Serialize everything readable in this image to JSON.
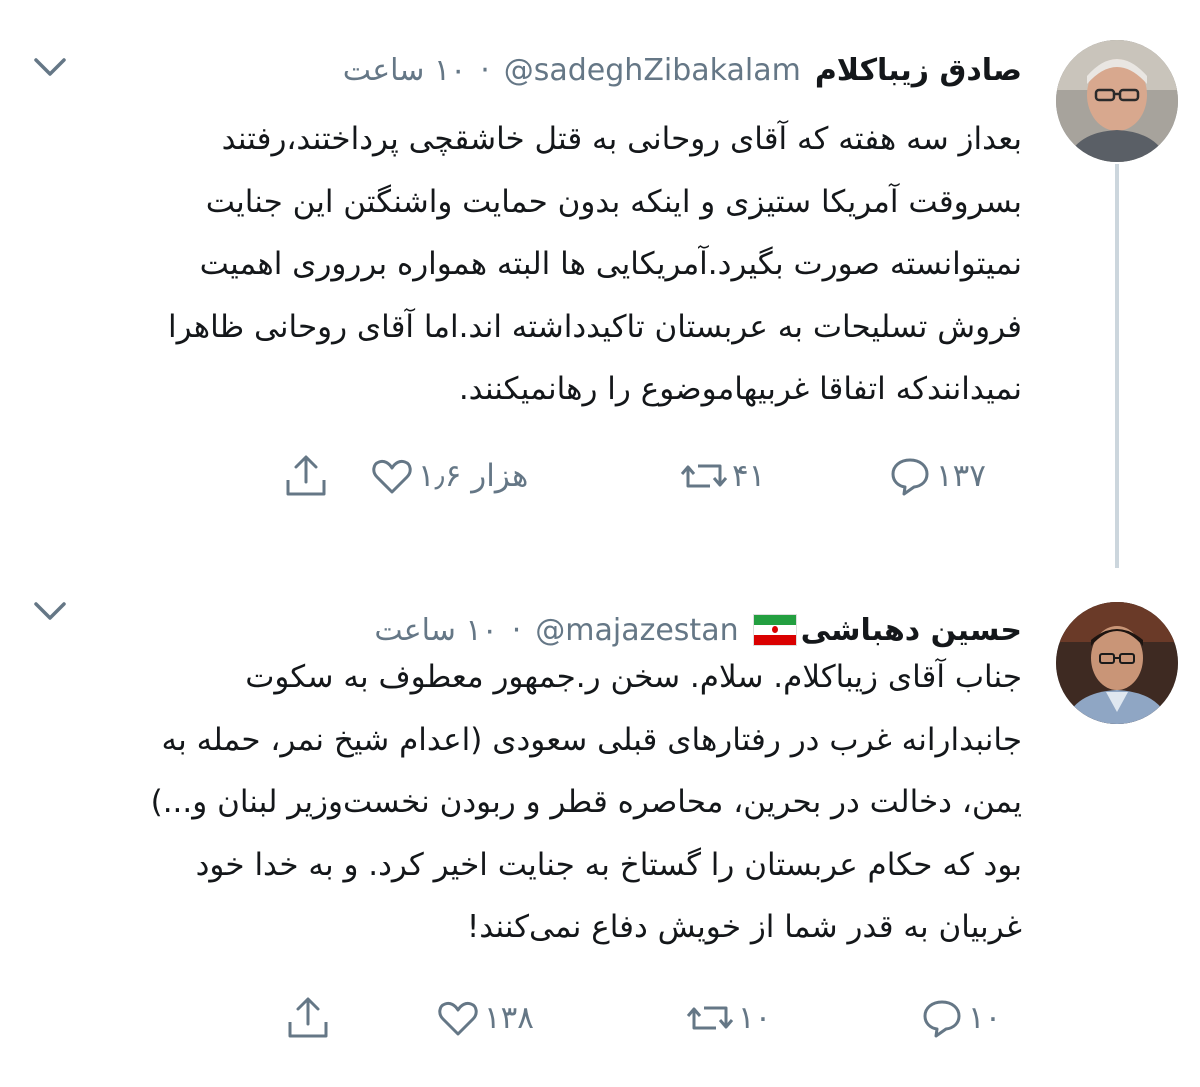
{
  "tweets": [
    {
      "display_name": "صادق زیباکلام",
      "handle": "@sadeghZibakalam",
      "time": "۱۰ ساعت",
      "lines": [
        "بعداز سه هفته که آقای روحانی به قتل خاشقچی پرداختند،رفتند",
        "بسروقت آمریکا ستیزی و اینکه بدون حمایت واشنگتن این جنایت",
        "نمیتوانسته صورت بگیرد.آمریکایی ها البته همواره برروری اهمیت",
        "فروش تسلیحات به عربستان تاکیدداشته اند.اما آقای روحانی ظاهرا",
        "نمیدانندکه اتفاقا غربیهاموضوع را رهانمیکنند."
      ],
      "replies": "۱۳۷",
      "retweets": "۴۱",
      "likes": "۱٫۶ هزار",
      "icons": [
        "reply-icon",
        "retweet-icon",
        "like-icon",
        "share-icon"
      ]
    },
    {
      "display_name": "حسین دهباشی",
      "flag": "iran-flag-icon",
      "handle": "@majazestan",
      "time": "۱۰ ساعت",
      "lines": [
        "جناب آقای زیباکلام. سلام. سخن ر.جمهور معطوف به سکوت",
        "جانبدارانه غرب در رفتارهای قبلی سعودی (اعدام شیخ نمر، حمله به",
        "یمن، دخالت در بحرین، محاصره قطر و ربودن نخست‌وزیر لبنان و...)",
        "بود که حکام عربستان را گستاخ به جنایت اخیر کرد. و به خدا خود",
        "غربیان به قدر شما از خویش دفاع نمی‌کنند!"
      ],
      "replies": "۱۰",
      "retweets": "۱۰",
      "likes": "۱۳۸",
      "icons": [
        "reply-icon",
        "retweet-icon",
        "like-icon",
        "share-icon"
      ]
    }
  ],
  "colors": {
    "text": "#14171a",
    "secondary": "#657786",
    "thread_line": "#ccd6dd"
  }
}
